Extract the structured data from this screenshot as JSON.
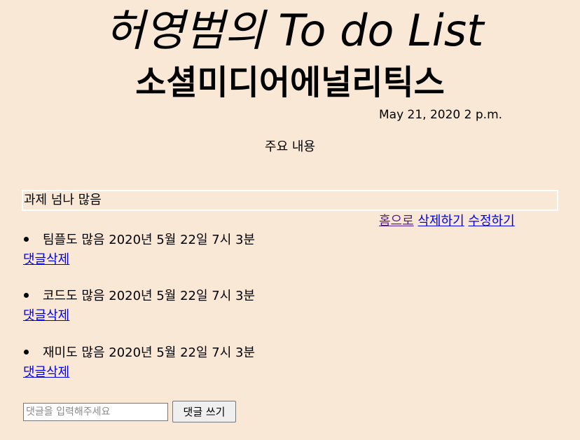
{
  "header": {
    "title": "허영범의 To do List",
    "subtitle": "소셜미디어에널리틱스",
    "date": "May 21, 2020 2 p.m."
  },
  "summary_label": "주요 내용",
  "content_text": "과제 넘나 많음",
  "actions": {
    "home": "홈으로",
    "delete": "삭제하기",
    "edit": "수정하기"
  },
  "comments": [
    {
      "text": "팀플도 많음 2020년 5월 22일 7시 3분",
      "delete_label": "댓글삭제"
    },
    {
      "text": "코드도 많음 2020년 5월 22일 7시 3분",
      "delete_label": "댓글삭제"
    },
    {
      "text": "재미도 많음 2020년 5월 22일 7시 3분",
      "delete_label": "댓글삭제"
    }
  ],
  "comment_form": {
    "placeholder": "댓글을 입력해주세요",
    "value": "",
    "submit_label": "댓글 쓰기"
  },
  "colors": {
    "background": "#fae8d6",
    "link": "#0000ee",
    "visited_link": "#551a8b",
    "content_border": "#ffffff"
  }
}
